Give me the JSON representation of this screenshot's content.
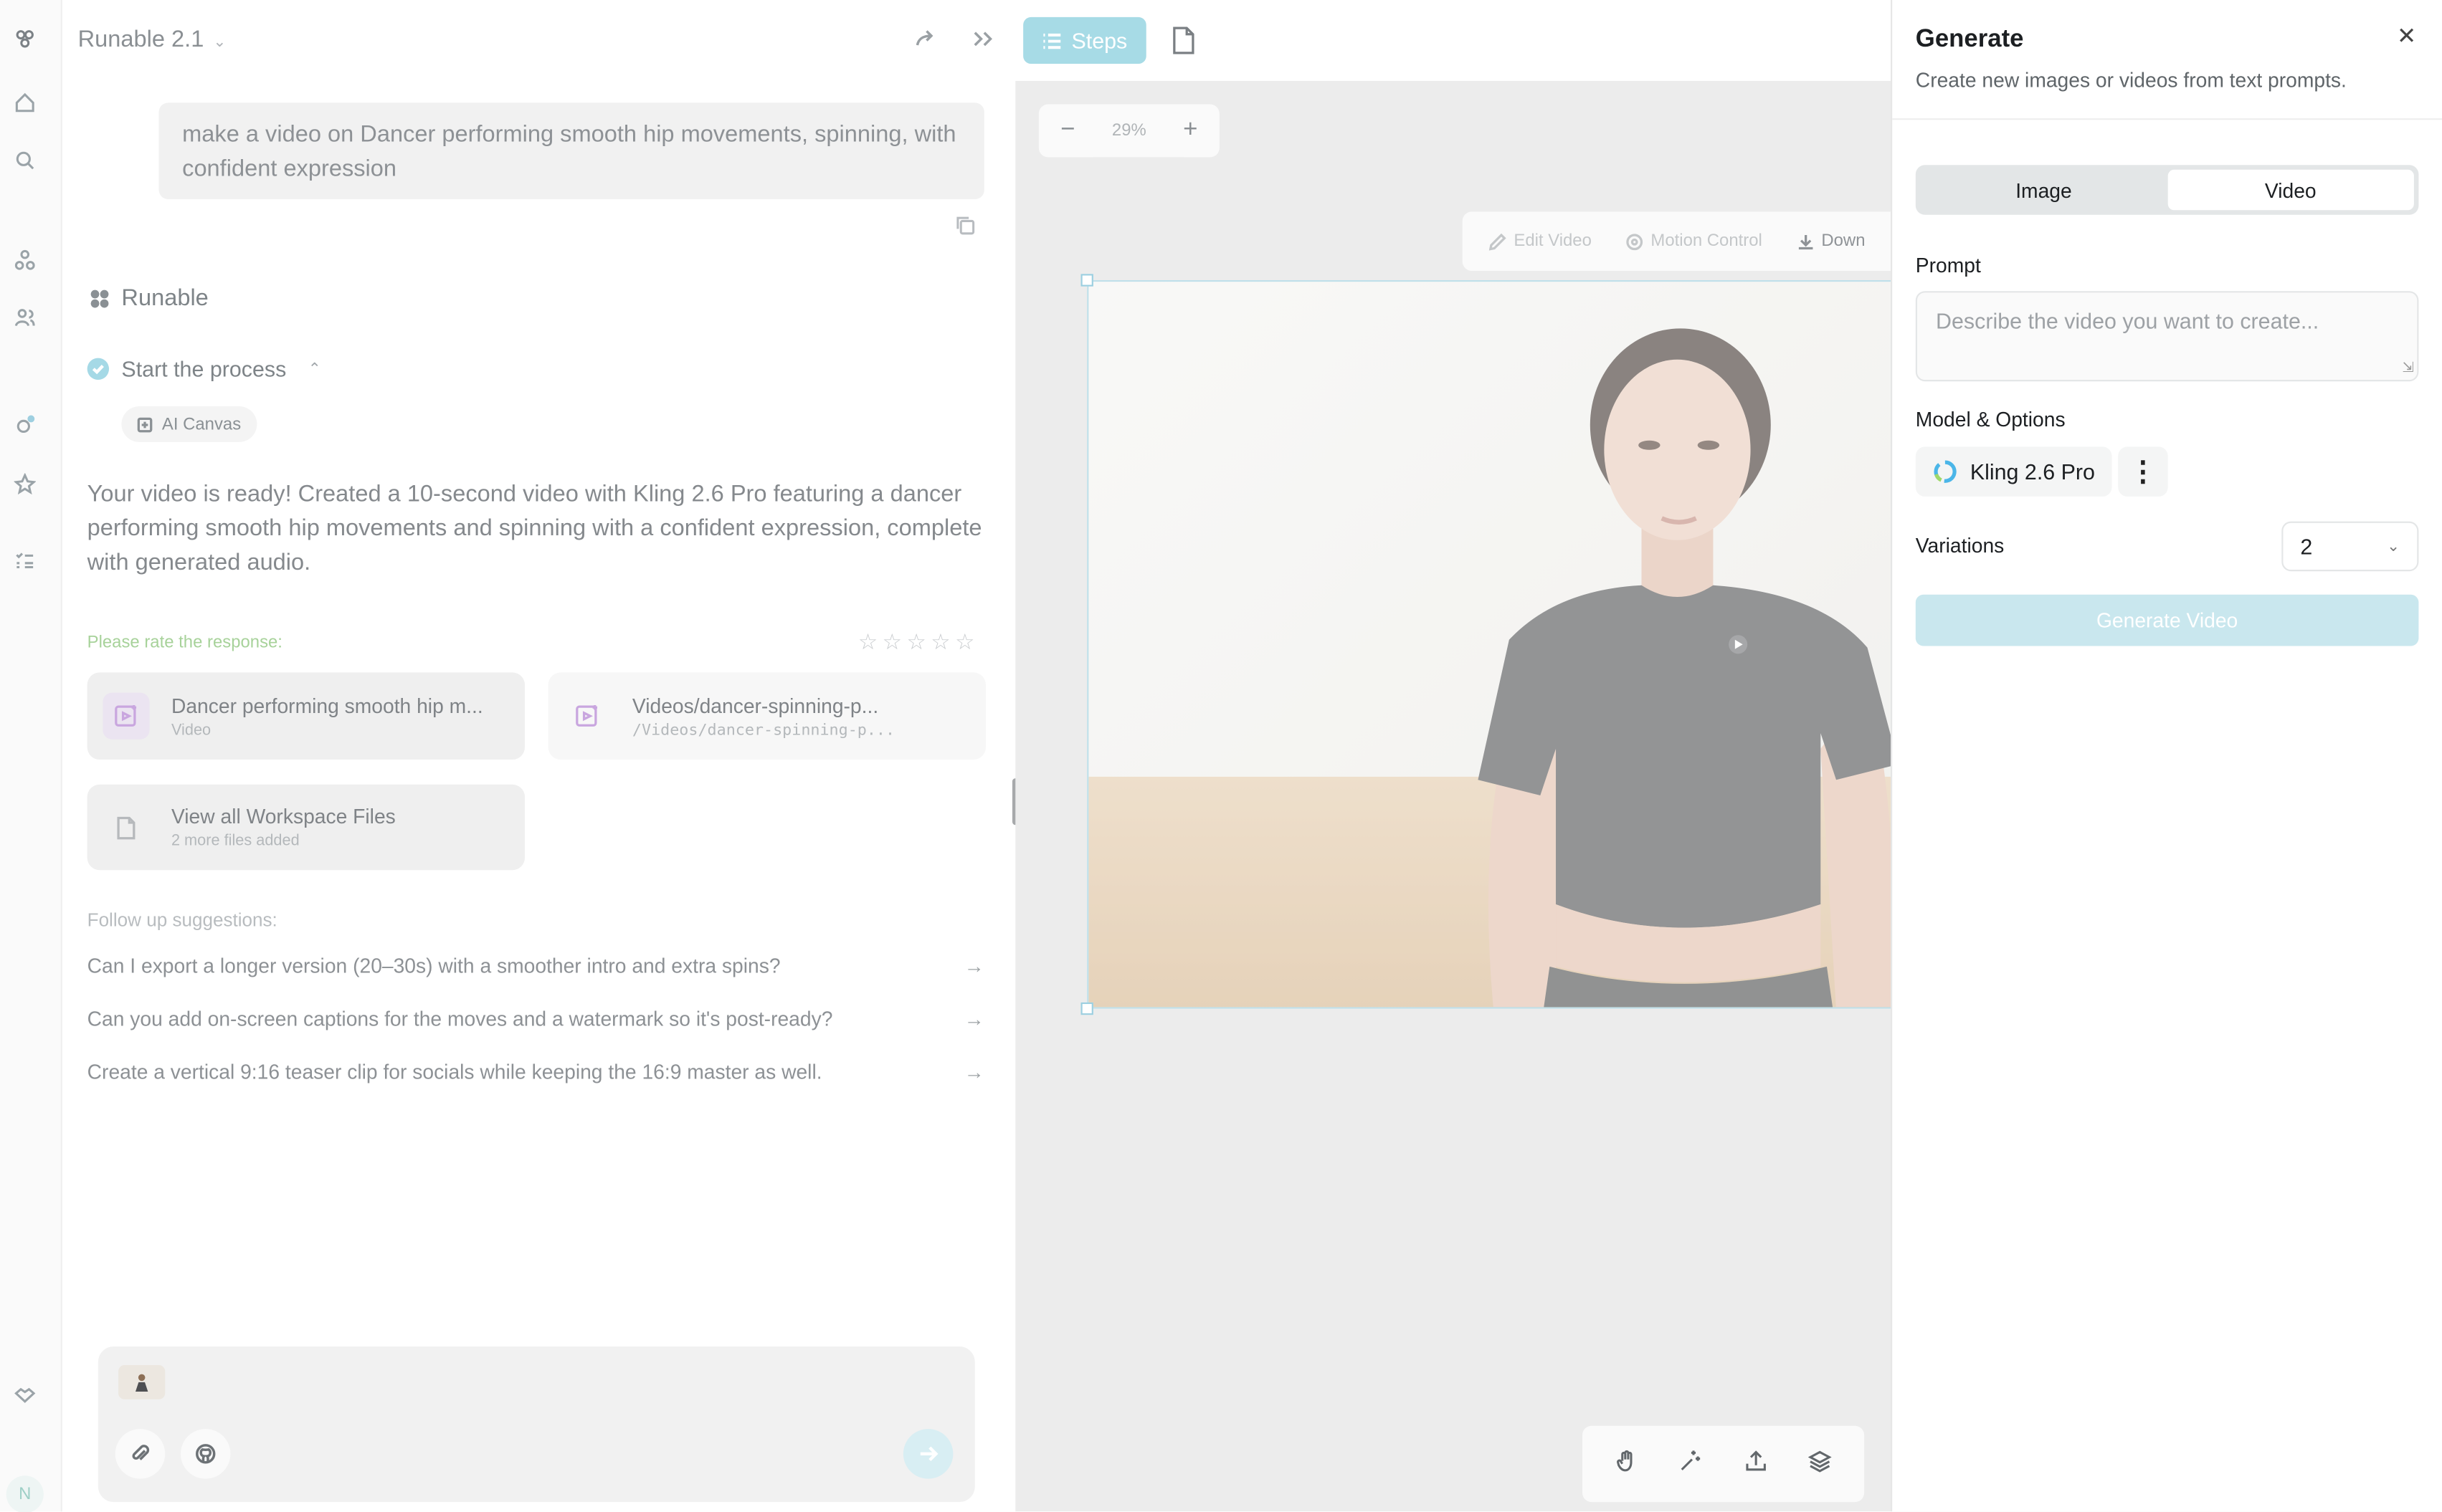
{
  "app": {
    "title": "Runable 2.1"
  },
  "conversation": {
    "user_message": "make a video on Dancer performing smooth hip movements, spinning, with confident expression",
    "assistant_name": "Runable",
    "step": {
      "label": "Start the process"
    },
    "chip_label": "AI Canvas",
    "answer": "Your video is ready! Created a 10-second video with Kling 2.6 Pro featuring a dancer performing smooth hip movements and spinning with a confident expression, complete with generated audio.",
    "rate_label": "Please rate the response:",
    "files": [
      {
        "name": "Dancer performing smooth hip m...",
        "sub": "Video"
      },
      {
        "name": "Videos/dancer-spinning-p...",
        "sub": "/Videos/dancer-spinning-p..."
      },
      {
        "name": "View all Workspace Files",
        "sub": "2 more files added"
      }
    ],
    "followup_label": "Follow up suggestions:",
    "followups": [
      "Can I export a longer version (20–30s) with a smoother intro and extra spins?",
      "Can you add on-screen captions for the moves and a watermark so it's post-ready?",
      "Create a vertical 9:16 teaser clip for socials while keeping the 16:9 master as well."
    ]
  },
  "rail": {
    "avatar_initial": "N"
  },
  "canvas": {
    "steps_label": "Steps",
    "zoom": "29%",
    "toolbar": {
      "edit": "Edit Video",
      "motion": "Motion Control",
      "download": "Down"
    }
  },
  "generate": {
    "title": "Generate",
    "subtitle": "Create new images or videos from text prompts.",
    "tabs": [
      "Image",
      "Video"
    ],
    "active_tab": "Video",
    "prompt_label": "Prompt",
    "prompt_placeholder": "Describe the video you want to create...",
    "model_label": "Model & Options",
    "model_name": "Kling 2.6 Pro",
    "variations_label": "Variations",
    "variations_value": "2",
    "button_label": "Generate Video"
  },
  "colors": {
    "accent": "#a7dbe6",
    "rate_green": "#a7d29a",
    "file_purple": "#c9a6df"
  }
}
